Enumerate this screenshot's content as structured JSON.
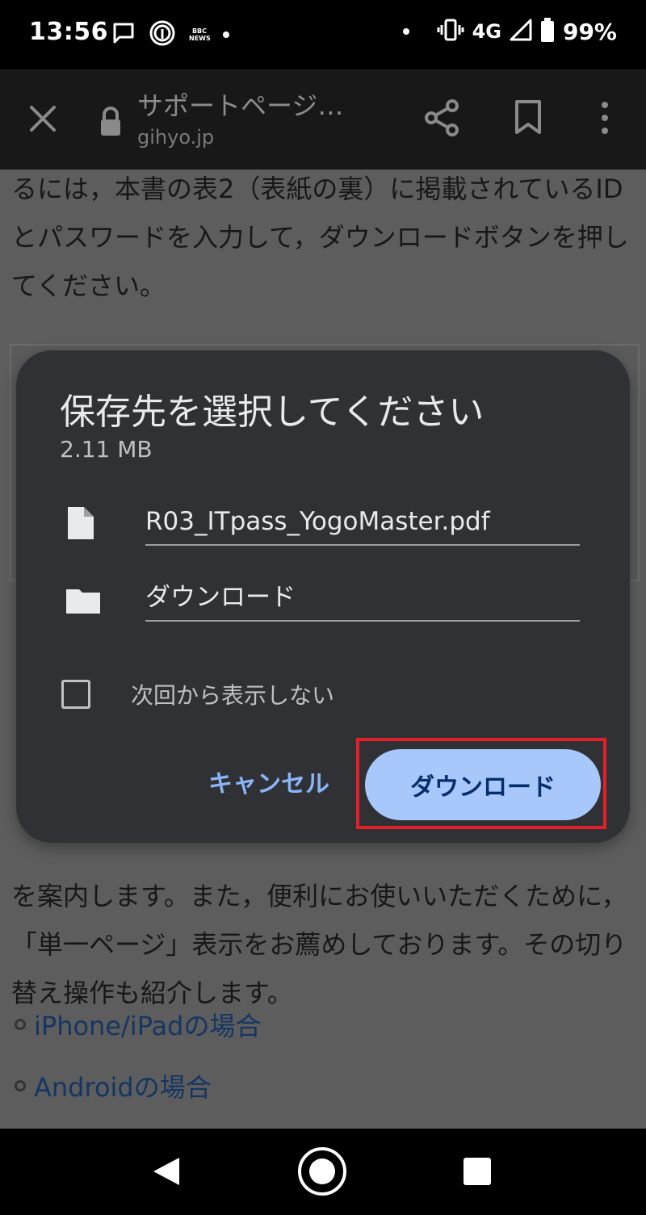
{
  "status_bar": {
    "time": "13:56",
    "bbc_line1": "BBC",
    "bbc_line2": "NEWS",
    "network": "4G",
    "battery": "99%"
  },
  "toolbar": {
    "title": "サポートページ…",
    "url": "gihyo.jp"
  },
  "page": {
    "paragraph_top": "るには，本書の表2（表紙の裏）に掲載されているIDとパスワードを入力して，ダウンロードボタンを押してください。",
    "paragraph_lower": "を案内します。また，便利にお使いいただくために，「単一ページ」表示をお薦めしております。その切り替え操作も紹介します。",
    "links": [
      "iPhone/iPadの場合",
      "Androidの場合"
    ]
  },
  "dialog": {
    "title": "保存先を選択してください",
    "file_size": "2.11 MB",
    "filename": "R03_ITpass_YogoMaster.pdf",
    "location": "ダウンロード",
    "checkbox_label": "次回から表示しない",
    "cancel_label": "キャンセル",
    "download_label": "ダウンロード"
  },
  "colors": {
    "dialog_bg": "#303134",
    "accent": "#8ab4f8",
    "primary_button": "#a8c7fa",
    "highlight": "#e3202a"
  }
}
